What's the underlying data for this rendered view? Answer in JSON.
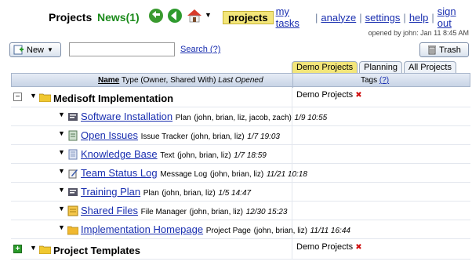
{
  "header": {
    "brand": "Projects",
    "news": "News(1)",
    "nav": [
      {
        "label": "projects",
        "active": true
      },
      {
        "label": "my tasks"
      },
      {
        "label": "analyze"
      },
      {
        "label": "settings"
      },
      {
        "label": "help"
      },
      {
        "label": "sign out"
      }
    ],
    "opened_by": "opened by john: Jan 11 8:45 AM"
  },
  "toolbar": {
    "new_label": "New",
    "search_value": "",
    "search_link": "Search (?)",
    "trash_label": "Trash"
  },
  "tabs": [
    "Demo Projects",
    "Planning",
    "All Projects"
  ],
  "table": {
    "header_name": "Name",
    "header_meta": "Type (Owner, Shared With)",
    "header_opened": "Last Opened",
    "header_tags": "Tags",
    "header_tags_help": "(?)"
  },
  "projects": [
    {
      "name": "Medisoft Implementation",
      "tag": "Demo Projects",
      "items": [
        {
          "name": "Software Installation",
          "type": "Plan",
          "people": "(john, brian, liz, jacob, zach)",
          "date": "1/9 10:55",
          "icon": "plan-icon"
        },
        {
          "name": "Open Issues",
          "type": "Issue Tracker",
          "people": "(john, brian, liz)",
          "date": "1/7 19:03",
          "icon": "issue-tracker-icon"
        },
        {
          "name": "Knowledge Base",
          "type": "Text",
          "people": "(john, brian, liz)",
          "date": "1/7 18:59",
          "icon": "text-doc-icon"
        },
        {
          "name": "Team Status Log",
          "type": "Message Log",
          "people": "(john, brian, liz)",
          "date": "11/21 10:18",
          "icon": "message-log-icon"
        },
        {
          "name": "Training Plan",
          "type": "Plan",
          "people": "(john, brian, liz)",
          "date": "1/5 14:47",
          "icon": "plan-icon"
        },
        {
          "name": "Shared Files",
          "type": "File Manager",
          "people": "(john, brian, liz)",
          "date": "12/30 15:23",
          "icon": "file-manager-icon"
        },
        {
          "name": "Implementation Homepage",
          "type": "Project Page",
          "people": "(john, brian, liz)",
          "date": "11/11 16:44",
          "icon": "project-page-icon"
        }
      ]
    },
    {
      "name": "Project Templates",
      "tag": "Demo Projects",
      "items": []
    }
  ]
}
